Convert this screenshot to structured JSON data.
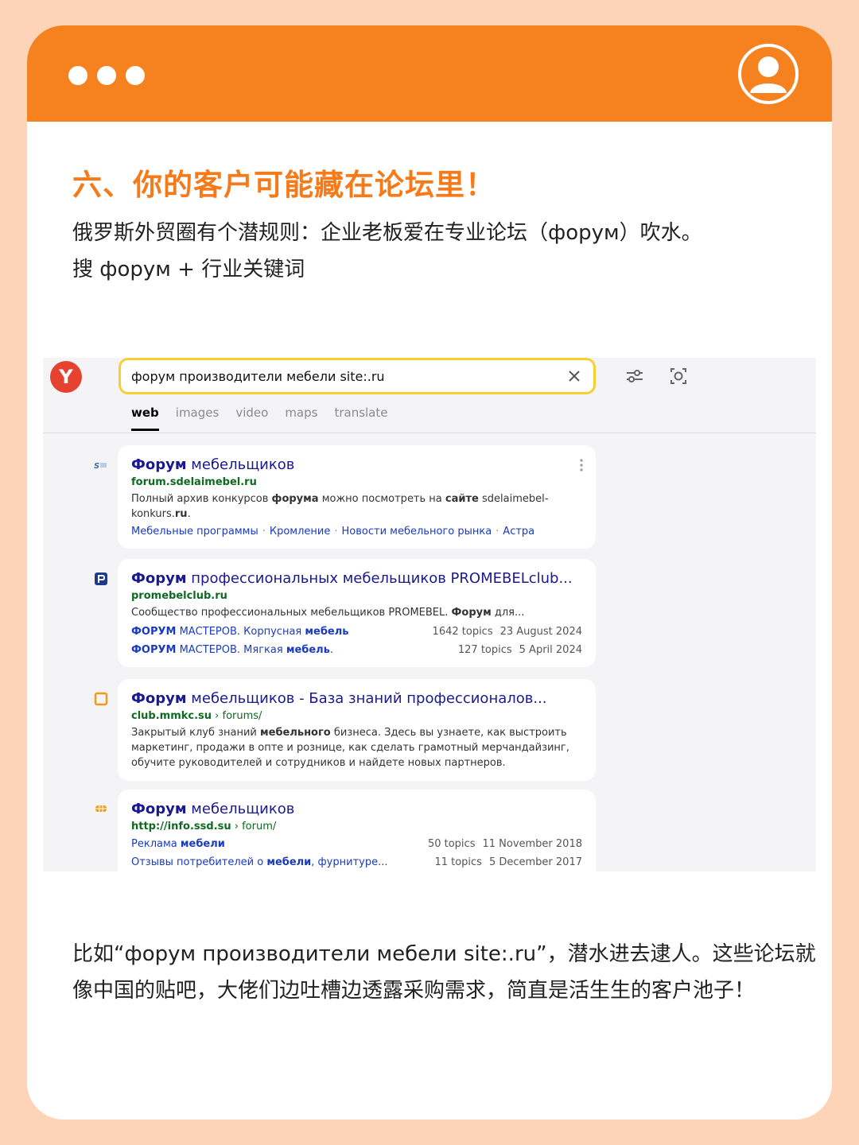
{
  "header": {
    "dots": [
      "dot",
      "dot",
      "dot"
    ],
    "user_icon": "user-circle-icon",
    "accent_color": "#f6821f",
    "background_color": "#fdd4b8"
  },
  "title": "六、你的客户可能藏在论坛里！",
  "intro": {
    "line1": "俄罗斯外贸圈有个潜规则：企业老板爱在专业论坛（форум）吹水。",
    "line2": "搜 форум + 行业关键词"
  },
  "search": {
    "logo": "Y",
    "query": "форум производители мебели site:.ru",
    "tabs": [
      "web",
      "images",
      "video",
      "maps",
      "translate"
    ],
    "active_tab": "web",
    "icons": [
      "clear-x-icon",
      "filter-sliders-icon",
      "image-search-icon"
    ]
  },
  "results": [
    {
      "favicon": "sdelaimebel-favicon",
      "title_bold": "Форум",
      "title_rest": " мебельщиков",
      "url": "forum.sdelaimebel.ru",
      "desc_parts": [
        "Полный архив конкурсов ",
        "форума",
        " можно посмотреть на ",
        "сайте",
        " sdelaimebel-konkurs.",
        "ru",
        "."
      ],
      "links": [
        "Мебельные программы",
        "Кромление",
        "Новости мебельного рынка",
        "Астра"
      ]
    },
    {
      "favicon": "promebel-favicon",
      "title_bold": "Форум",
      "title_rest": " профессиональных мебельщиков PROMEBELclub...",
      "url": "promebelclub.ru",
      "desc_parts": [
        "Сообщество профессиональных мебельщиков PROMEBEL. ",
        "Форум",
        " для..."
      ],
      "rows": [
        {
          "bold1": "ФОРУМ",
          "mid": " МАСТЕРОВ. Корпусная ",
          "bold2": "мебель",
          "end": "",
          "topics": "1642 topics",
          "date": "23 August 2024"
        },
        {
          "bold1": "ФОРУМ",
          "mid": " МАСТЕРОВ. Мягкая ",
          "bold2": "мебель",
          "end": ".",
          "topics": "127 topics",
          "date": "5 April 2024"
        }
      ]
    },
    {
      "favicon": "mmkc-favicon",
      "title_bold": "Форум",
      "title_rest": " мебельщиков - База знаний профессионалов...",
      "url": "club.mmkc.su",
      "url_path": " › forums/",
      "desc_parts": [
        "Закрытый клуб знаний ",
        "мебельного",
        " бизнеса. Здесь вы узнаете, как выстроить маркетинг, продажи в опте и рознице, как сделать грамотный мерчандайзинг, обучите руководителей и сотрудников и найдете новых партнеров."
      ]
    },
    {
      "favicon": "ssd-favicon",
      "title_bold": "Форум",
      "title_rest": " мебельщиков",
      "url": "http://info.ssd.su",
      "url_path": " › forum/",
      "rows": [
        {
          "bold1": "",
          "mid": "Реклама ",
          "bold2": "мебели",
          "end": "",
          "topics": "50 topics",
          "date": "11 November 2018"
        },
        {
          "bold1": "",
          "mid": "Отзывы потребителей о ",
          "bold2": "мебели",
          "end": ", фурнитуре...",
          "topics": "11 topics",
          "date": "5 December 2017"
        }
      ]
    }
  ],
  "outro": {
    "line1": "比如“форум производители мебели site:.ru”，潜水进去逮人。这些论坛就",
    "line2": "像中国的贴吧，大佬们边吐槽边透露采购需求，简直是活生生的客户池子！"
  }
}
